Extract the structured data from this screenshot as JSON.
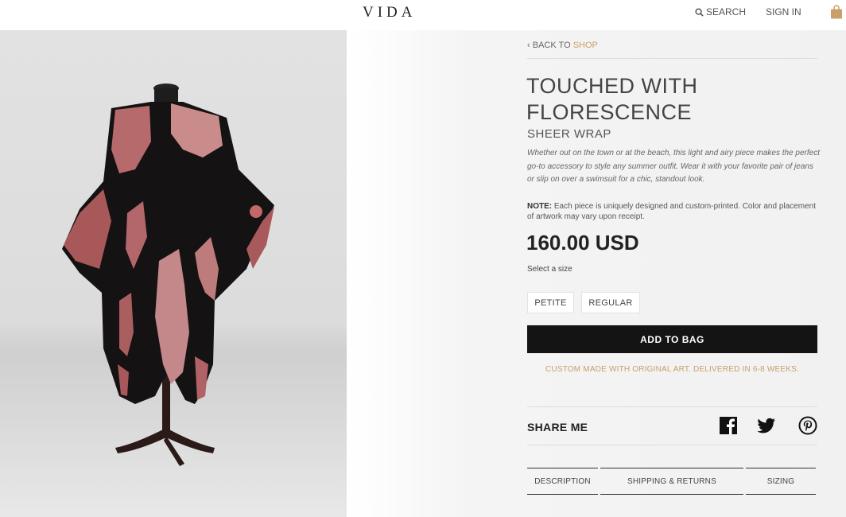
{
  "header": {
    "logo": "VIDA",
    "search_label": "SEARCH",
    "signin_label": "SIGN IN",
    "icons": {
      "search": "search-icon",
      "bag": "shopping-bag-icon"
    }
  },
  "product_image": {
    "caption": ""
  },
  "breadcrumb": {
    "back_label": "BACK TO",
    "shop_label": "SHOP"
  },
  "product": {
    "title": "TOUCHED WITH FLORESCENCE",
    "subtitle": "SHEER WRAP",
    "description": "Whether out on the town or at the beach, this light and airy piece makes the perfect go-to accessory to style any summer outfit. Wear it with your favorite pair of jeans or slip on over a swimsuit for a chic, standout look.",
    "note_label": "NOTE:",
    "note_text": " Each piece is uniquely designed and custom-printed. Color and placement of artwork may vary upon receipt.",
    "price": "160.00 USD",
    "select_size_label": "Select a size",
    "sizes": [
      "PETITE",
      "REGULAR"
    ],
    "add_to_bag_label": "ADD TO BAG",
    "custom_note": "CUSTOM MADE WITH ORIGINAL ART. DELIVERED IN 6-8 WEEKS."
  },
  "share": {
    "label": "SHARE ME",
    "icons": [
      "facebook-icon",
      "twitter-icon",
      "pinterest-icon"
    ]
  },
  "tabs": [
    "DESCRIPTION",
    "SHIPPING & RETURNS",
    "SIZING"
  ],
  "colors": {
    "accent_gold": "#c8a06a",
    "button_black": "#141414",
    "background_grey": "#f1f1f1"
  }
}
